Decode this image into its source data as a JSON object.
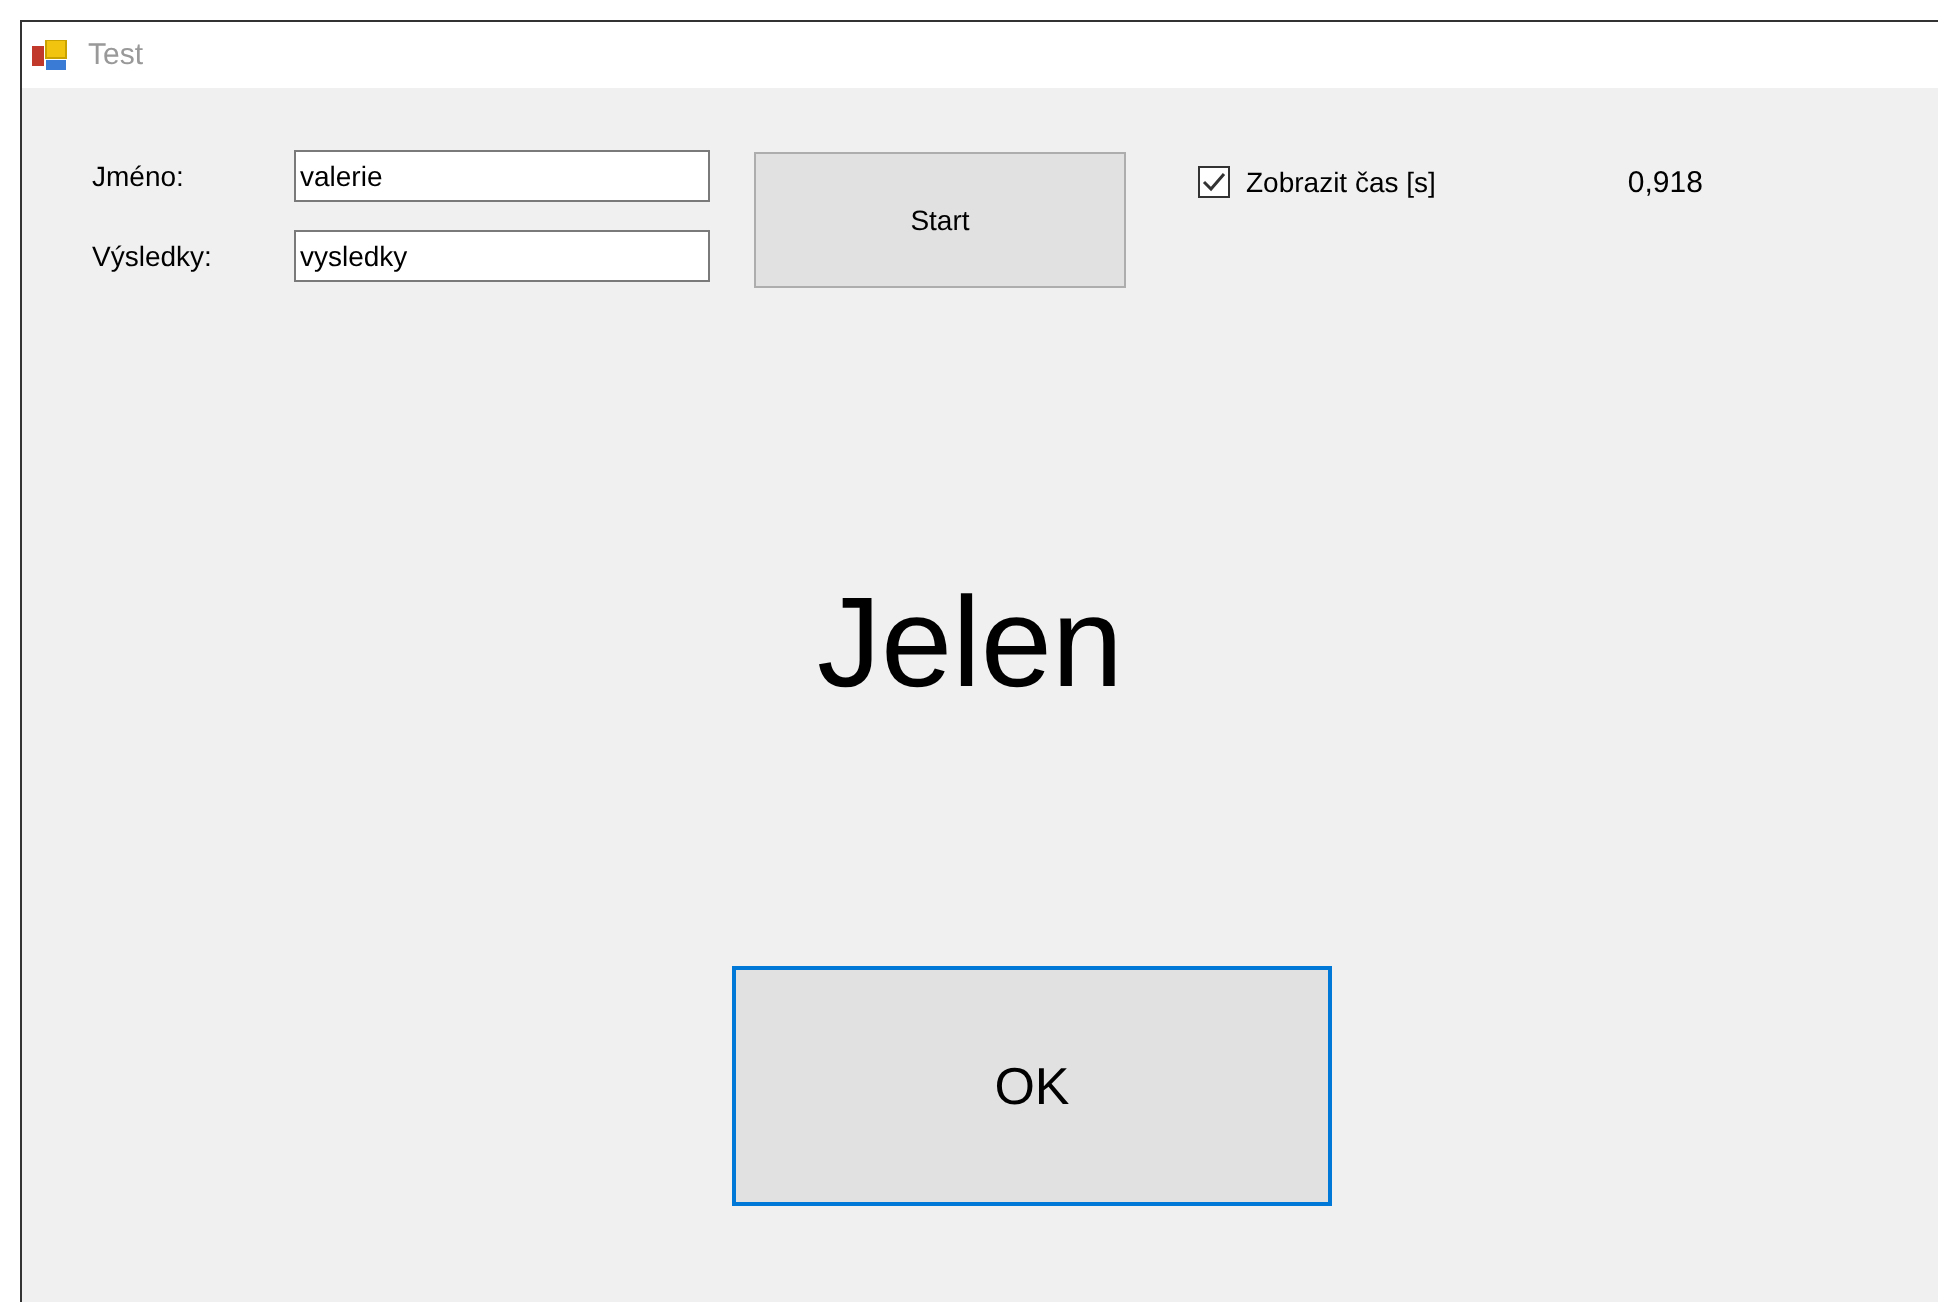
{
  "window": {
    "title": "Test"
  },
  "fields": [
    {
      "label": "Jméno:",
      "value": "valerie"
    },
    {
      "label": "Výsledky:",
      "value": "vysledky"
    }
  ],
  "start_button": {
    "label": "Start"
  },
  "show_time": {
    "label": "Zobrazit čas [s]",
    "checked": true
  },
  "time": "0,918",
  "word": "Jelen",
  "ok_button": {
    "label": "OK",
    "focused": true
  }
}
